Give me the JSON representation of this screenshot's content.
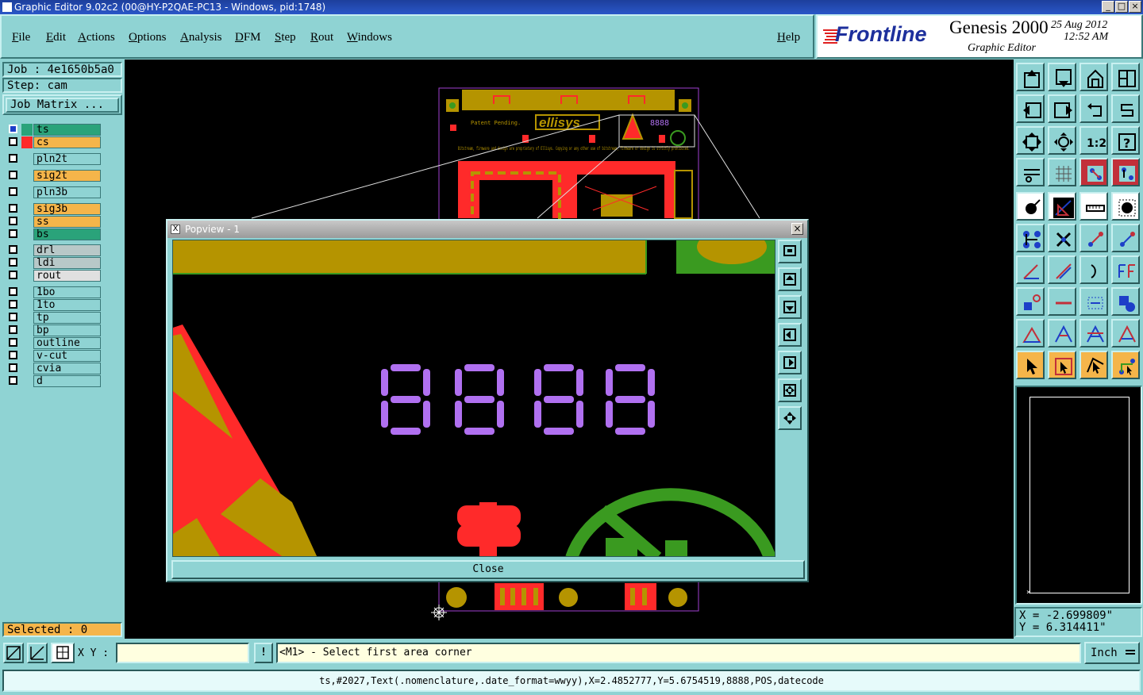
{
  "window": {
    "title": "Graphic Editor 9.02c2 (00@HY-P2QAE-PC13 - Windows, pid:1748)"
  },
  "menu": [
    {
      "label": "File"
    },
    {
      "label": "Edit"
    },
    {
      "label": "Actions"
    },
    {
      "label": "Options"
    },
    {
      "label": "Analysis"
    },
    {
      "label": "DFM"
    },
    {
      "label": "Step"
    },
    {
      "label": "Rout"
    },
    {
      "label": "Windows"
    },
    {
      "label": "Help"
    }
  ],
  "brand": {
    "logo": "Frontline",
    "product": "Genesis 2000",
    "subtitle": "Graphic Editor",
    "date": "25 Aug 2012",
    "time": "12:52 AM"
  },
  "job": {
    "label": "Job : 4e1650b5a0",
    "step": "Step: cam",
    "matrix_button": "Job Matrix ..."
  },
  "layers": [
    {
      "name": "ts",
      "color": "#2aa37a",
      "swatch": "#2aa37a",
      "active": true
    },
    {
      "name": "cs",
      "color": "#f5b54a",
      "swatch": "#ff2a2a"
    },
    {
      "name": "pln2t",
      "color": "#8fd3d3"
    },
    {
      "name": "sig2t",
      "color": "#f5b54a"
    },
    {
      "name": "pln3b",
      "color": "#8fd3d3"
    },
    {
      "name": "sig3b",
      "color": "#f5b54a"
    },
    {
      "name": "ss",
      "color": "#f5b54a"
    },
    {
      "name": "bs",
      "color": "#2aa37a"
    },
    {
      "name": "drl",
      "color": "#b8c8c8"
    },
    {
      "name": "ldi",
      "color": "#b8c8c8"
    },
    {
      "name": "rout",
      "color": "#e0e0e0"
    },
    {
      "name": "1bo",
      "color": "#8fd3d3"
    },
    {
      "name": "1to",
      "color": "#8fd3d3"
    },
    {
      "name": "tp",
      "color": "#8fd3d3"
    },
    {
      "name": "bp",
      "color": "#8fd3d3"
    },
    {
      "name": "outline",
      "color": "#8fd3d3"
    },
    {
      "name": "v-cut",
      "color": "#8fd3d3"
    },
    {
      "name": "cvia",
      "color": "#8fd3d3"
    },
    {
      "name": "d",
      "color": "#8fd3d3"
    }
  ],
  "selected": "Selected : 0",
  "board": {
    "brand_text": "ellisys",
    "patent_text": "Patent Pending.",
    "copyright_text": "Bitstream, firmware and design are proprietary of Ellisys. Copying or any other use of bitstream, firmware or design is strictly prohibited.",
    "datecode": "8888"
  },
  "popview": {
    "title": "Popview - 1",
    "digits": "8888",
    "close_label": "Close"
  },
  "coords": {
    "x": "X = -2.699809\"",
    "y": "Y = 6.314411\""
  },
  "statusbar": {
    "xy_label": "X Y :",
    "xy_value": "",
    "prompt": "<M1> - Select first area corner",
    "units": "Inch",
    "info": "ts,#2027,Text(.nomenclature,.date_format=wwyy),X=2.4852777,Y=5.6754519,8888,POS,datecode"
  },
  "colors": {
    "background": "#8fd3d3",
    "canvas": "#000000",
    "segment": "#b070f0",
    "copper": "#ff2a2a",
    "silkscreen": "#b59400",
    "ground": "#3a9a20"
  }
}
